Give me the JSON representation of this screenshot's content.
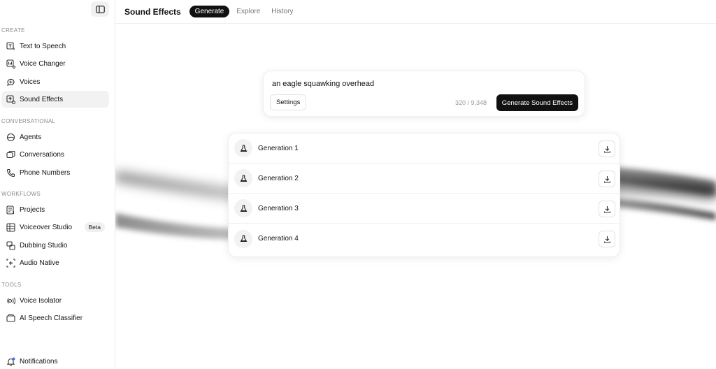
{
  "sidebar": {
    "sections": {
      "create": "CREATE",
      "conversational": "CONVERSATIONAL",
      "workflows": "WORKFLOWS",
      "tools": "TOOLS"
    },
    "items": [
      {
        "label": "Text to Speech",
        "icon": "text-to-speech-icon"
      },
      {
        "label": "Voice Changer",
        "icon": "voice-changer-icon"
      },
      {
        "label": "Voices",
        "icon": "voices-icon"
      },
      {
        "label": "Sound Effects",
        "icon": "sound-effects-icon",
        "active": true
      },
      {
        "label": "Agents",
        "icon": "agents-icon"
      },
      {
        "label": "Conversations",
        "icon": "conversations-icon"
      },
      {
        "label": "Phone Numbers",
        "icon": "phone-icon"
      },
      {
        "label": "Projects",
        "icon": "projects-icon"
      },
      {
        "label": "Voiceover Studio",
        "icon": "voiceover-studio-icon",
        "badge": "Beta"
      },
      {
        "label": "Dubbing Studio",
        "icon": "dubbing-studio-icon"
      },
      {
        "label": "Audio Native",
        "icon": "audio-native-icon"
      },
      {
        "label": "Voice Isolator",
        "icon": "voice-isolator-icon"
      },
      {
        "label": "AI Speech Classifier",
        "icon": "speech-classifier-icon"
      },
      {
        "label": "Notifications",
        "icon": "bell-icon"
      }
    ]
  },
  "header": {
    "title": "Sound Effects",
    "tabs": [
      {
        "label": "Generate",
        "active": true
      },
      {
        "label": "Explore"
      },
      {
        "label": "History"
      }
    ]
  },
  "prompt": {
    "text": "an eagle squawking overhead",
    "settings_label": "Settings",
    "char_count": "320 / 9,348",
    "generate_label": "Generate Sound Effects"
  },
  "generations": [
    {
      "label": "Generation 1"
    },
    {
      "label": "Generation 2"
    },
    {
      "label": "Generation 3"
    },
    {
      "label": "Generation 4"
    }
  ],
  "colors": {
    "accent": "#111111",
    "active_bg": "#f2f2f2",
    "muted_text": "#8a8a8a"
  }
}
